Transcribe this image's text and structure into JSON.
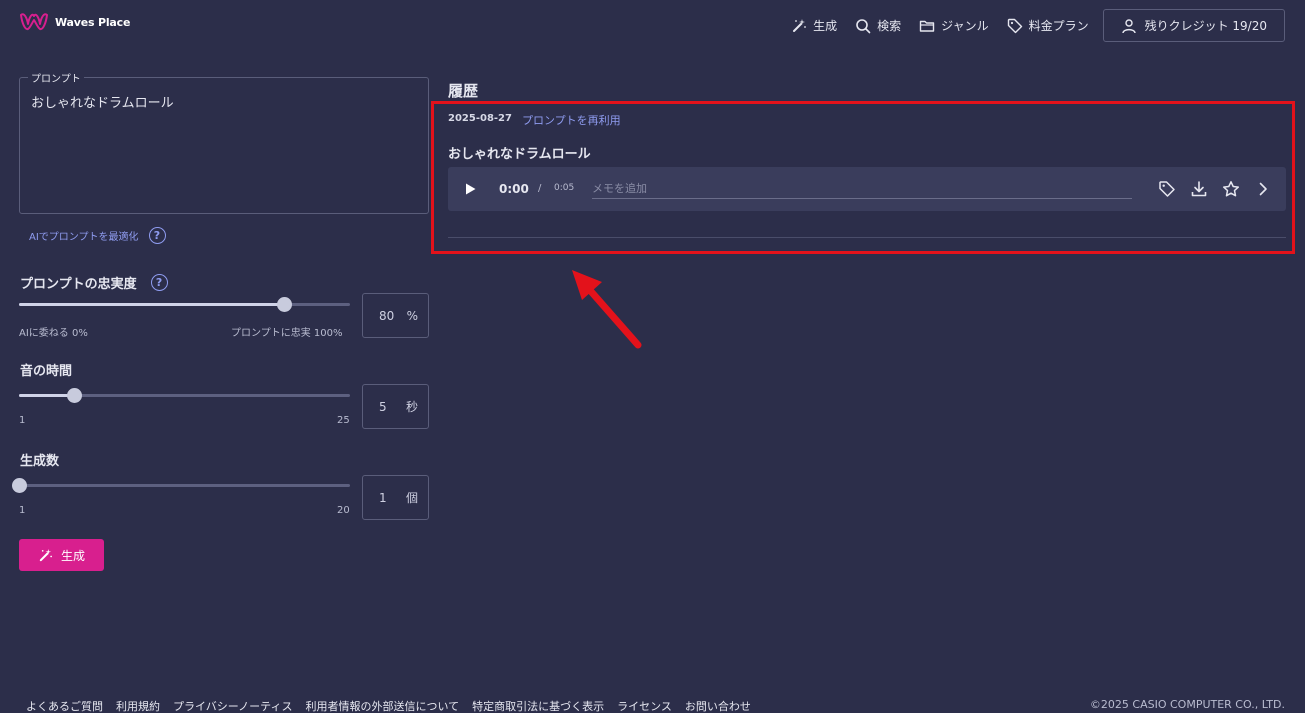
{
  "brand": {
    "name": "Waves Place",
    "color": "#d81f8e"
  },
  "nav": {
    "generate": "生成",
    "search": "検索",
    "genre": "ジャンル",
    "pricing": "料金プラン",
    "credits": "残りクレジット 19/20"
  },
  "prompt": {
    "legend": "プロンプト",
    "value": "おしゃれなドラムロール",
    "optimize_link": "AIでプロンプトを最適化"
  },
  "fidelity": {
    "title": "プロンプトの忠実度",
    "min_label": "AIに委ねる 0%",
    "max_label": "プロンプトに忠実 100%",
    "value": "80",
    "unit": "%",
    "fraction": 0.8
  },
  "duration": {
    "title": "音の時間",
    "min_label": "1",
    "max_label": "25",
    "value": "5",
    "unit": "秒",
    "fraction": 0.1667
  },
  "count": {
    "title": "生成数",
    "min_label": "1",
    "max_label": "20",
    "value": "1",
    "unit": "個",
    "fraction": 0
  },
  "generate_button": {
    "label": "生成"
  },
  "history": {
    "title": "履歴",
    "date": "2025-08-27",
    "reuse_link": "プロンプトを再利用",
    "name": "おしゃれなドラムロール",
    "time_current": "0:00",
    "time_separator": "/",
    "time_total": "0:05",
    "memo_placeholder": "メモを追加"
  },
  "footer": {
    "links": [
      "よくあるご質問",
      "利用規約",
      "プライバシーノーティス",
      "利用者情報の外部送信について",
      "特定商取引法に基づく表示",
      "ライセンス",
      "お問い合わせ"
    ],
    "copyright": "©2025 CASIO COMPUTER CO., LTD."
  },
  "annotation": {
    "highlight_color": "#e3121b"
  }
}
